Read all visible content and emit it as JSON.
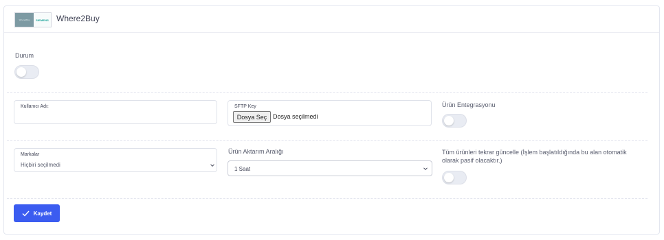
{
  "header": {
    "logo_left_text": "Where2Buy",
    "logo_right_text": "SIEMENS",
    "title": "Where2Buy"
  },
  "fields": {
    "status_label": "Durum",
    "username_label": "Kullanıcı Adı:",
    "sftp_label": "SFTP Key",
    "file_button": "Dosya Seç",
    "file_status": "Dosya seçilmedi",
    "product_integration_label": "Ürün Entegrasyonu",
    "brands_label": "Markalar",
    "brands_value": "Hiçbiri seçilmedi",
    "transfer_interval_label": "Ürün Aktarım Aralığı",
    "transfer_interval_value": "1 Saat",
    "update_all_label": "Tüm ürünleri tekrar güncelle (İşlem başlatıldığında bu alan otomatik olarak pasif olacaktır.)"
  },
  "toggles": {
    "status_on": false,
    "product_integration_on": false,
    "update_all_on": false
  },
  "actions": {
    "save_label": "Kaydet"
  },
  "colors": {
    "primary": "#3b5cf0",
    "toggle_off": "#e9ecf3"
  }
}
